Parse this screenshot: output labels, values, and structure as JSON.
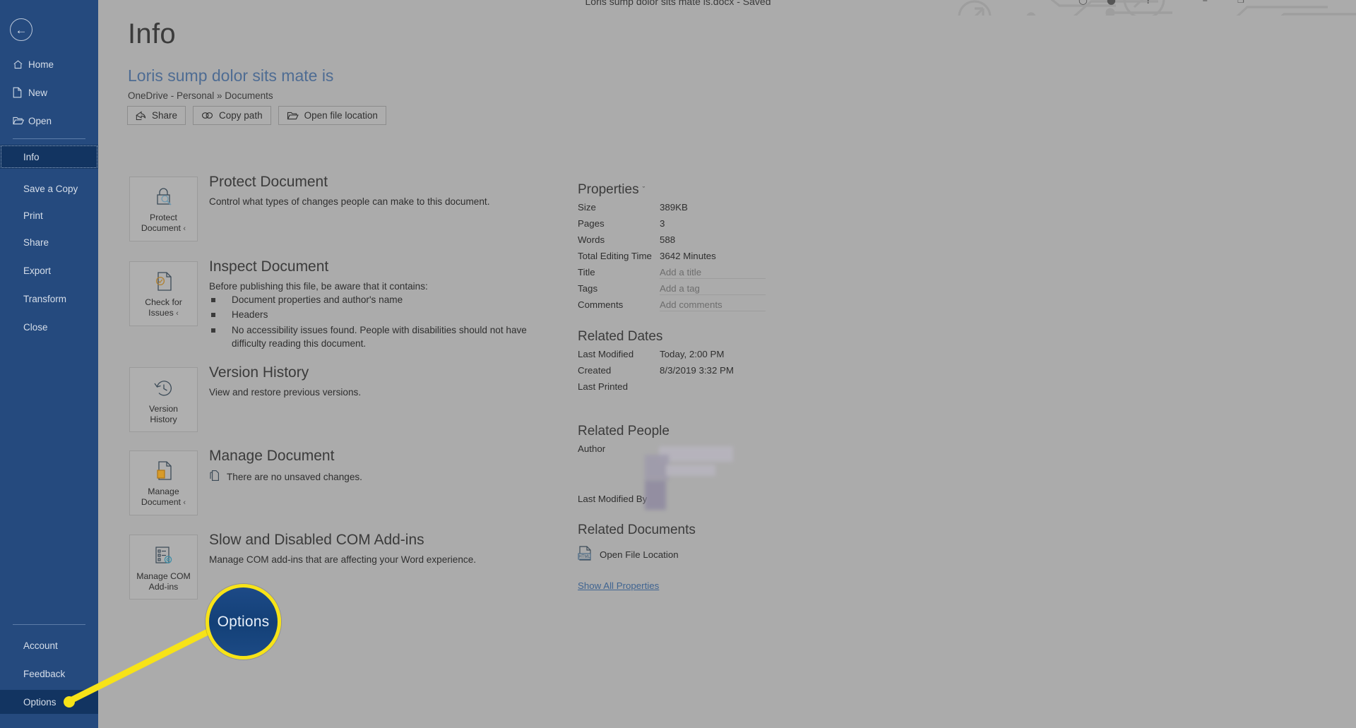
{
  "titlebar": {
    "document_title": "Loris sump dolor sits mate is.docx  -  Saved",
    "help_icon": "?",
    "minimize_icon": "–",
    "restore_icon": "❐",
    "ribbon_options_icon": "⌃"
  },
  "sidebar": {
    "back_label": "←",
    "items": [
      {
        "label": "Home",
        "icon": "home-icon",
        "state": "normal"
      },
      {
        "label": "New",
        "icon": "new-document-icon",
        "state": "normal"
      },
      {
        "label": "Open",
        "icon": "open-folder-icon",
        "state": "normal"
      },
      {
        "label": "Info",
        "icon": "",
        "state": "active"
      },
      {
        "label": "Save a Copy",
        "icon": "",
        "state": "normal"
      },
      {
        "label": "Print",
        "icon": "",
        "state": "normal"
      },
      {
        "label": "Share",
        "icon": "",
        "state": "normal"
      },
      {
        "label": "Export",
        "icon": "",
        "state": "normal"
      },
      {
        "label": "Transform",
        "icon": "",
        "state": "normal"
      },
      {
        "label": "Close",
        "icon": "",
        "state": "normal"
      },
      {
        "label": "Account",
        "icon": "",
        "state": "normal"
      },
      {
        "label": "Feedback",
        "icon": "",
        "state": "normal"
      },
      {
        "label": "Options",
        "icon": "",
        "state": "active"
      }
    ]
  },
  "header": {
    "page_title": "Info",
    "document_name": "Loris sump dolor sits mate is",
    "document_path": "OneDrive - Personal » Documents",
    "buttons": [
      {
        "label": "Share",
        "icon": "share-icon"
      },
      {
        "label": "Copy path",
        "icon": "link-icon"
      },
      {
        "label": "Open file location",
        "icon": "folder-icon"
      }
    ]
  },
  "sections": [
    {
      "tile_label": "Protect\nDocument",
      "tile_icon": "lock-magnifier-icon",
      "tile_has_chevron": true,
      "heading": "Protect Document",
      "body": "Control what types of changes people can make to this document."
    },
    {
      "tile_label": "Check for\nIssues",
      "tile_icon": "document-check-icon",
      "tile_has_chevron": true,
      "heading": "Inspect Document",
      "body": "Before publishing this file, be aware that it contains:",
      "bullets": [
        "Document properties and author's name",
        "Headers",
        "No accessibility issues found. People with disabilities should not have difficulty reading this document."
      ]
    },
    {
      "tile_label": "Version\nHistory",
      "tile_icon": "clock-history-icon",
      "tile_has_chevron": false,
      "heading": "Version History",
      "body": "View and restore previous versions."
    },
    {
      "tile_label": "Manage\nDocument",
      "tile_icon": "document-manage-icon",
      "tile_has_chevron": true,
      "heading": "Manage Document",
      "note": "There are no unsaved changes.",
      "note_icon": "unsaved-changes-icon"
    },
    {
      "tile_label": "Manage COM\nAdd-ins",
      "tile_icon": "com-addins-icon",
      "tile_has_chevron": false,
      "heading": "Slow and Disabled COM Add-ins",
      "body": "Manage COM add-ins that are affecting your Word experience."
    }
  ],
  "properties": {
    "heading": "Properties",
    "chevron": "ˇ",
    "rows": [
      {
        "key": "Size",
        "value": "389KB",
        "placeholder": false
      },
      {
        "key": "Pages",
        "value": "3",
        "placeholder": false
      },
      {
        "key": "Words",
        "value": "588",
        "placeholder": false
      },
      {
        "key": "Total Editing Time",
        "value": "3642 Minutes",
        "placeholder": false
      },
      {
        "key": "Title",
        "value": "Add a title",
        "placeholder": true
      },
      {
        "key": "Tags",
        "value": "Add a tag",
        "placeholder": true
      },
      {
        "key": "Comments",
        "value": "Add comments",
        "placeholder": true
      }
    ]
  },
  "related_dates": {
    "heading": "Related Dates",
    "rows": [
      {
        "key": "Last Modified",
        "value": "Today, 2:00 PM"
      },
      {
        "key": "Created",
        "value": "8/3/2019 3:32 PM"
      },
      {
        "key": "Last Printed",
        "value": ""
      }
    ]
  },
  "related_people": {
    "heading": "Related People",
    "rows": [
      {
        "key": "Author",
        "value": ""
      },
      {
        "key": "Last Modified By",
        "value": ""
      }
    ]
  },
  "related_documents": {
    "heading": "Related Documents",
    "link_label": "Open File Location",
    "link_icon": "html-file-icon",
    "show_all_label": "Show All Properties"
  },
  "callout": {
    "label": "Options",
    "ring_color": "#F7E318",
    "fill_color": "#16427B"
  },
  "colors": {
    "sidebar_blue": "#254A7E",
    "sidebar_active": "#123461",
    "page_background": "#ABABAB",
    "accent_link": "#3F6491",
    "doc_name_blue": "#4E6C93"
  }
}
